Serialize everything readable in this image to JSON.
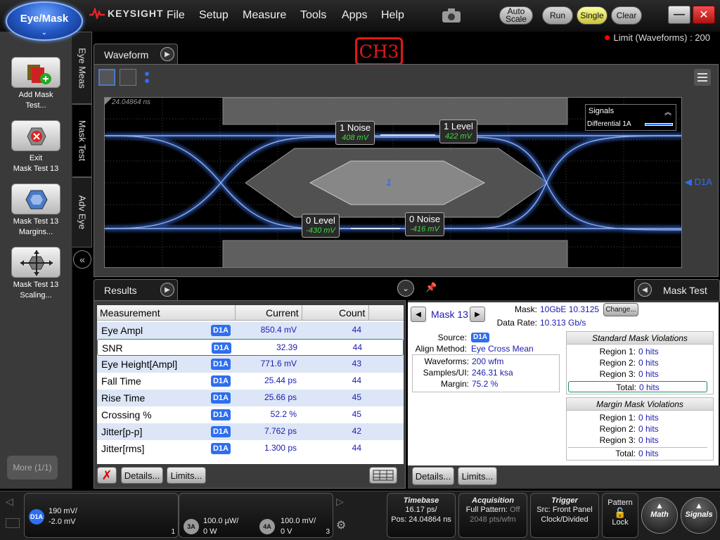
{
  "app": {
    "mode_badge": "Eye/Mask",
    "brand": "KEYSIGHT"
  },
  "menu": [
    "File",
    "Setup",
    "Measure",
    "Tools",
    "Apps",
    "Help"
  ],
  "run_controls": {
    "autoscale": "Auto Scale",
    "run": "Run",
    "single": "Single",
    "clear": "Clear"
  },
  "window": {
    "minimize": "—",
    "close": "✕"
  },
  "annotation": "CH3",
  "limit_text": "Limit (Waveforms) : 200",
  "sidebar": {
    "tools": [
      {
        "label_line1": "Add Mask",
        "label_line2": "Test..."
      },
      {
        "label_line1": "Exit",
        "label_line2": "Mask Test 13"
      },
      {
        "label_line1": "Mask Test 13",
        "label_line2": "Margins..."
      },
      {
        "label_line1": "Mask Test 13",
        "label_line2": "Scaling..."
      }
    ],
    "more": "More (1/1)"
  },
  "vertical_tabs": [
    "Eye Meas",
    "Mask Test",
    "Adv Eye"
  ],
  "waveform": {
    "tab": "Waveform",
    "timestamp": "24.04864 ns",
    "signals_title": "Signals",
    "signals_item": "Differential 1A",
    "channel_marker": "D1A",
    "region_label": "1",
    "markers": {
      "one_noise": {
        "label": "1 Noise",
        "value": "408 mV"
      },
      "one_level": {
        "label": "1 Level",
        "value": "422 mV"
      },
      "zero_level": {
        "label": "0 Level",
        "value": "-430 mV"
      },
      "zero_noise": {
        "label": "0 Noise",
        "value": "-416 mV"
      }
    }
  },
  "results": {
    "tab": "Results",
    "headers": {
      "measurement": "Measurement",
      "current": "Current",
      "count": "Count"
    },
    "rows": [
      {
        "name": "Eye Ampl",
        "source": "D1A",
        "current": "850.4 mV",
        "count": "44"
      },
      {
        "name": "SNR",
        "source": "D1A",
        "current": "32.39",
        "count": "44"
      },
      {
        "name": "Eye Height[Ampl]",
        "source": "D1A",
        "current": "771.6 mV",
        "count": "43"
      },
      {
        "name": "Fall Time",
        "source": "D1A",
        "current": "25.44 ps",
        "count": "44"
      },
      {
        "name": "Rise Time",
        "source": "D1A",
        "current": "25.66 ps",
        "count": "45"
      },
      {
        "name": "Crossing %",
        "source": "D1A",
        "current": "52.2 %",
        "count": "45"
      },
      {
        "name": "Jitter[p-p]",
        "source": "D1A",
        "current": "7.762 ps",
        "count": "42"
      },
      {
        "name": "Jitter[rms]",
        "source": "D1A",
        "current": "1.300 ps",
        "count": "44"
      }
    ],
    "delete": "✗",
    "details": "Details...",
    "limits": "Limits..."
  },
  "mask_test": {
    "tab": "Mask Test",
    "name": "Mask 13",
    "mask_label": "Mask:",
    "mask_value": "10GbE 10.3125",
    "change": "Change...",
    "rate_label": "Data Rate:",
    "rate_value": "10.313 Gb/s",
    "source_label": "Source:",
    "source_value": "D1A",
    "align_label": "Align Method:",
    "align_value": "Eye Cross Mean",
    "waveforms_label": "Waveforms:",
    "waveforms_value": "200 wfm",
    "samples_label": "Samples/UI:",
    "samples_value": "246.31 ksa",
    "margin_label": "Margin:",
    "margin_value": "75.2 %",
    "standard": {
      "title": "Standard Mask Violations",
      "regions": [
        {
          "label": "Region 1:",
          "value": "0 hits"
        },
        {
          "label": "Region 2:",
          "value": "0 hits"
        },
        {
          "label": "Region 3:",
          "value": "0 hits"
        }
      ],
      "total_label": "Total:",
      "total_value": "0 hits"
    },
    "margin_box": {
      "title": "Margin Mask Violations",
      "regions": [
        {
          "label": "Region 1:",
          "value": "0 hits"
        },
        {
          "label": "Region 2:",
          "value": "0 hits"
        },
        {
          "label": "Region 3:",
          "value": "0 hits"
        }
      ],
      "total_label": "Total:",
      "total_value": "0 hits"
    },
    "details": "Details...",
    "limits": "Limits..."
  },
  "status": {
    "ch1": {
      "badge": "D1A",
      "line1": "190 mV/",
      "line2": "-2.0 mV",
      "slot": "1"
    },
    "ch3a": {
      "badge": "3A",
      "line1": "100.0 µW/",
      "line2": "0 W"
    },
    "ch4a": {
      "badge": "4A",
      "line1": "100.0 mV/",
      "line2": "0 V",
      "slot": "3"
    },
    "timebase": {
      "title": "Timebase",
      "line1": "16.17 ps/",
      "line2": "Pos: 24.04864 ns"
    },
    "acquisition": {
      "title": "Acquisition",
      "line1a": "Full Pattern:",
      "line1b": "Off",
      "line2": "2048 pts/wfm"
    },
    "trigger": {
      "title": "Trigger",
      "line1": "Src: Front Panel",
      "line2": "Clock/Divided"
    },
    "pattern": {
      "title": "Pattern",
      "line2": "Lock"
    },
    "math": "Math",
    "signals": "Signals"
  },
  "colors": {
    "accent_blue": "#2e6ef0",
    "annotation_red": "#e01818",
    "measure_green": "#3ddc3d",
    "single_yellow": "#ecea6a"
  }
}
